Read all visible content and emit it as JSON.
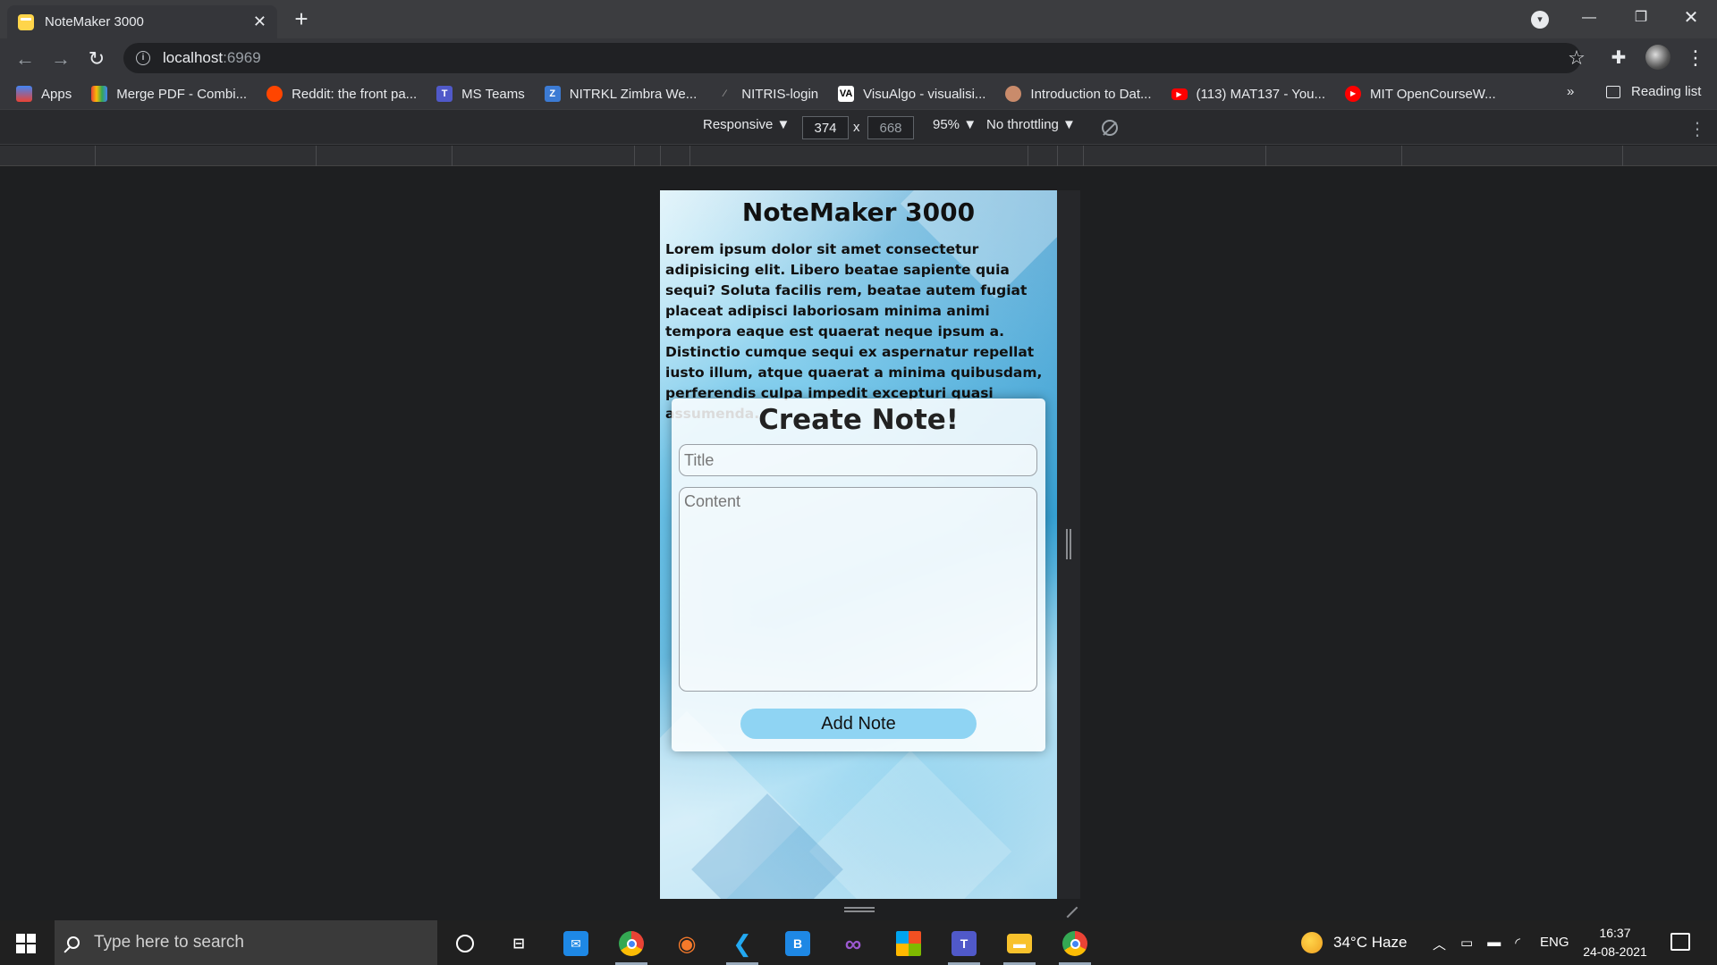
{
  "browser": {
    "tab_title": "NoteMaker 3000",
    "tab_close": "✕",
    "new_tab": "+",
    "url_host": "localhost",
    "url_port": ":6969",
    "bookmarks": [
      {
        "label": "Apps",
        "color": "#4285f4"
      },
      {
        "label": "Merge PDF - Combi...",
        "color": "#e94235"
      },
      {
        "label": "Reddit: the front pa...",
        "color": "#ff4500"
      },
      {
        "label": "MS Teams",
        "color": "#5059c9"
      },
      {
        "label": "NITRKL Zimbra We...",
        "color": "#d44638"
      },
      {
        "label": "NITRIS-login",
        "color": "#777777"
      },
      {
        "label": "VisuAlgo - visualisi...",
        "color": "#000000"
      },
      {
        "label": "Introduction to Dat...",
        "color": "#c98b6b"
      },
      {
        "label": "(113) MAT137 - You...",
        "color": "#ff0000"
      },
      {
        "label": "MIT OpenCourseW...",
        "color": "#ff0000"
      }
    ],
    "bookmarks_more": "»",
    "reading_list": "Reading list"
  },
  "devtools": {
    "device": "Responsive ▼",
    "width": "374",
    "times": "x",
    "height": "668",
    "zoom": "95% ▼",
    "throttling": "No throttling ▼"
  },
  "app": {
    "title": "NoteMaker 3000",
    "description": "Lorem ipsum dolor sit amet consectetur adipisicing elit. Libero beatae sapiente quia sequi? Soluta facilis rem, beatae autem fugiat placeat adipisci laboriosam minima animi tempora eaque est quaerat neque ipsum a. Distinctio cumque sequi ex aspernatur repellat iusto illum, atque quaerat a minima quibusdam, perferendis culpa impedit excepturi quasi assumenda.",
    "form": {
      "heading": "Create Note!",
      "title_placeholder": "Title",
      "title_value": "",
      "content_placeholder": "Content",
      "content_value": "",
      "submit_label": "Add Note"
    }
  },
  "taskbar": {
    "search_placeholder": "Type here to search",
    "weather": "34°C  Haze",
    "language": "ENG",
    "time": "16:37",
    "date": "24-08-2021"
  }
}
